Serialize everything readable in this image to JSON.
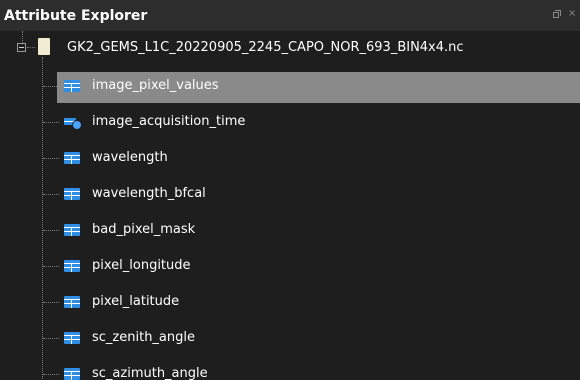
{
  "panel": {
    "title": "Attribute Explorer"
  },
  "tree": {
    "root_label": "GK2_GEMS_L1C_20220905_2245_CAPO_NOR_693_BIN4x4.nc",
    "items": [
      {
        "label": "image_pixel_values",
        "icon": "table-icon",
        "selected": true
      },
      {
        "label": "image_acquisition_time",
        "icon": "attribute-icon",
        "selected": false
      },
      {
        "label": "wavelength",
        "icon": "table-icon",
        "selected": false
      },
      {
        "label": "wavelength_bfcal",
        "icon": "table-icon",
        "selected": false
      },
      {
        "label": "bad_pixel_mask",
        "icon": "table-icon",
        "selected": false
      },
      {
        "label": "pixel_longitude",
        "icon": "table-icon",
        "selected": false
      },
      {
        "label": "pixel_latitude",
        "icon": "table-icon",
        "selected": false
      },
      {
        "label": "sc_zenith_angle",
        "icon": "table-icon",
        "selected": false
      },
      {
        "label": "sc_azimuth_angle",
        "icon": "table-icon",
        "selected": false
      }
    ]
  },
  "colors": {
    "background": "#1e1e1e",
    "titlebar": "#2d2d2d",
    "selection": "#8a8a8a",
    "icon_blue": "#2f8ee6"
  }
}
